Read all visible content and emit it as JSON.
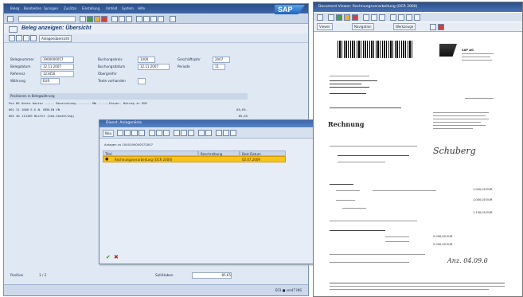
{
  "sap": {
    "menu": [
      "Beleg",
      "Bearbeiten",
      "Springen",
      "Zusätze",
      "Einstellung",
      "Umfeld",
      "System",
      "Hilfe"
    ],
    "logo": "SAP",
    "title": "Beleg anzeigen: Übersicht",
    "toolbar_button": "Anlagenübersicht",
    "fields": [
      {
        "label": "Belegnummer",
        "value": "1900000057"
      },
      {
        "label": "Belegdatum",
        "value": "12.11.2007"
      },
      {
        "label": "Referenz",
        "value": "123456"
      },
      {
        "label": "Währung",
        "value": "EUR"
      }
    ],
    "fields_right": [
      {
        "label": "Buchungskreis",
        "value": "1000"
      },
      {
        "label": "Buchungsdatum",
        "value": "12.11.2007"
      },
      {
        "label": "Übergreifnr",
        "value": ""
      },
      {
        "label": "Texte vorhanden",
        "value": ""
      }
    ],
    "fields_far": [
      {
        "label": "Geschäftsjahr",
        "value": "2007"
      },
      {
        "label": "Periode",
        "value": "11"
      }
    ],
    "grid_header": "Positionen in Belegwährung",
    "grid_columns": "Pos BS  Konto  Kontor ----- Bezeichnung ------- MW ------Steuer- Betrag in   EUR",
    "grid_rows": [
      {
        "text": "001 31        1000         E.E.N. BERLIN         VN",
        "amount": "85,65-"
      },
      {
        "text": "002 40        113109       Bezfkt (Geb-Sendeltag)",
        "amount": "85,65"
      }
    ],
    "status": {
      "position_label": "Position",
      "position_value": "1 / 2",
      "saldo_label": "Soll/Haben",
      "saldo_value": "85,65",
      "right": "E03  ■  vm47  INS"
    }
  },
  "popup": {
    "title": "Dienst: Anlagenliste",
    "toolbar_new": "Neu",
    "subtitle": "Anlagen zu 1000190000572007",
    "columns": [
      "Titel",
      "Beschreibung",
      "Best.Datum"
    ],
    "row": {
      "title": "Rechnungsverarbeitung (OCR 2000)",
      "desc": "",
      "date": "02.07.2009"
    }
  },
  "document": {
    "title": "Document Viewer: Rechnungsverarbeitung (OCR 2000)",
    "nav": [
      "Viewer",
      "Navigation",
      "Werkzeuge"
    ],
    "company": "SAP AG",
    "heading": "Rechnung",
    "totals": [
      "1.000,00 EUR",
      "1.000,00 EUR",
      "1.150,00 EUR",
      "2.000,00 EUR",
      "2.000,00 EUR"
    ],
    "signature": "Schuberg",
    "date_note": "Anz. 04.09.0"
  }
}
